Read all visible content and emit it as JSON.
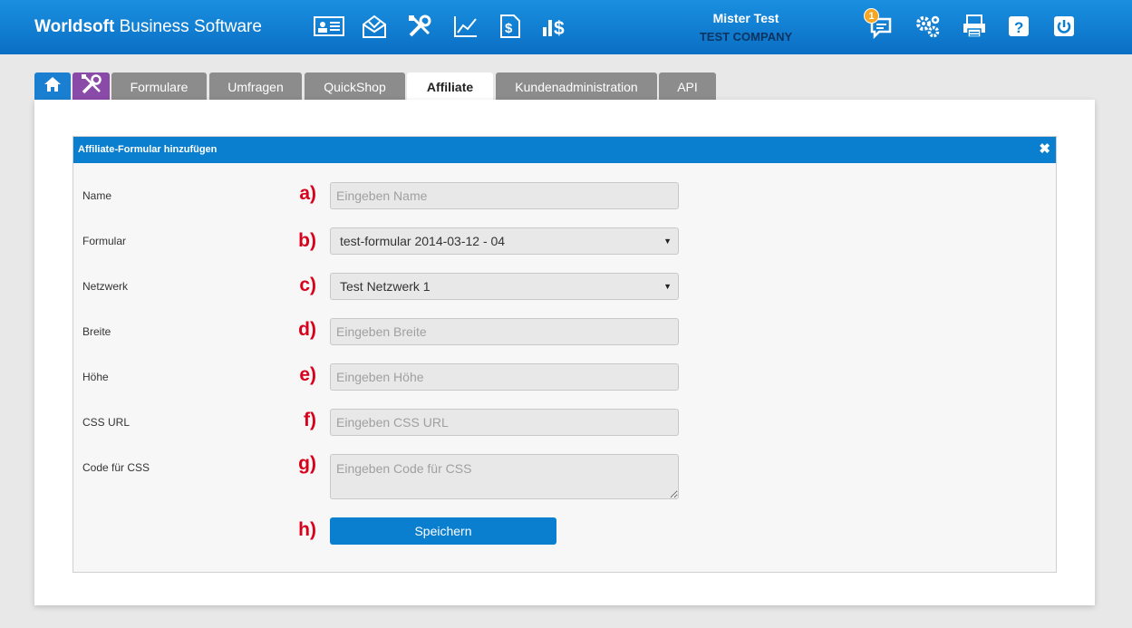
{
  "header": {
    "brand_bold": "Worldsoft",
    "brand_rest": " Business Software",
    "user_name": "Mister Test",
    "company": "TEST COMPANY",
    "notification_count": "1"
  },
  "tabs": [
    {
      "label": "Formulare"
    },
    {
      "label": "Umfragen"
    },
    {
      "label": "QuickShop"
    },
    {
      "label": "Affiliate",
      "active": true
    },
    {
      "label": "Kundenadministration"
    },
    {
      "label": "API"
    }
  ],
  "dialog": {
    "title": "Affiliate-Formular hinzufügen",
    "close_symbol": "✖",
    "fields": [
      {
        "label": "Name",
        "marker": "a)",
        "placeholder": "Eingeben Name"
      },
      {
        "label": "Formular",
        "marker": "b)",
        "value": "test-formular 2014-03-12 - 04"
      },
      {
        "label": "Netzwerk",
        "marker": "c)",
        "value": "Test Netzwerk 1"
      },
      {
        "label": "Breite",
        "marker": "d)",
        "placeholder": "Eingeben Breite"
      },
      {
        "label": "Höhe",
        "marker": "e)",
        "placeholder": "Eingeben Höhe"
      },
      {
        "label": "CSS URL",
        "marker": "f)",
        "placeholder": "Eingeben CSS URL"
      },
      {
        "label": "Code für CSS",
        "marker": "g)",
        "placeholder": "Eingeben Code für CSS"
      }
    ],
    "save_marker": "h)",
    "save_label": "Speichern"
  },
  "icons": {
    "top": [
      "contact-card-icon",
      "envelope-icon",
      "tools-icon",
      "chart-line-icon",
      "dollar-document-icon",
      "bar-dollar-icon"
    ],
    "right": [
      "chat-icon",
      "gears-icon",
      "printer-icon",
      "help-icon",
      "power-icon"
    ]
  },
  "colors": {
    "header": "#0a7fd0",
    "active_tab": "#ffffff",
    "markers": "#d9001b",
    "tools_tab": "#8a4aa8"
  }
}
